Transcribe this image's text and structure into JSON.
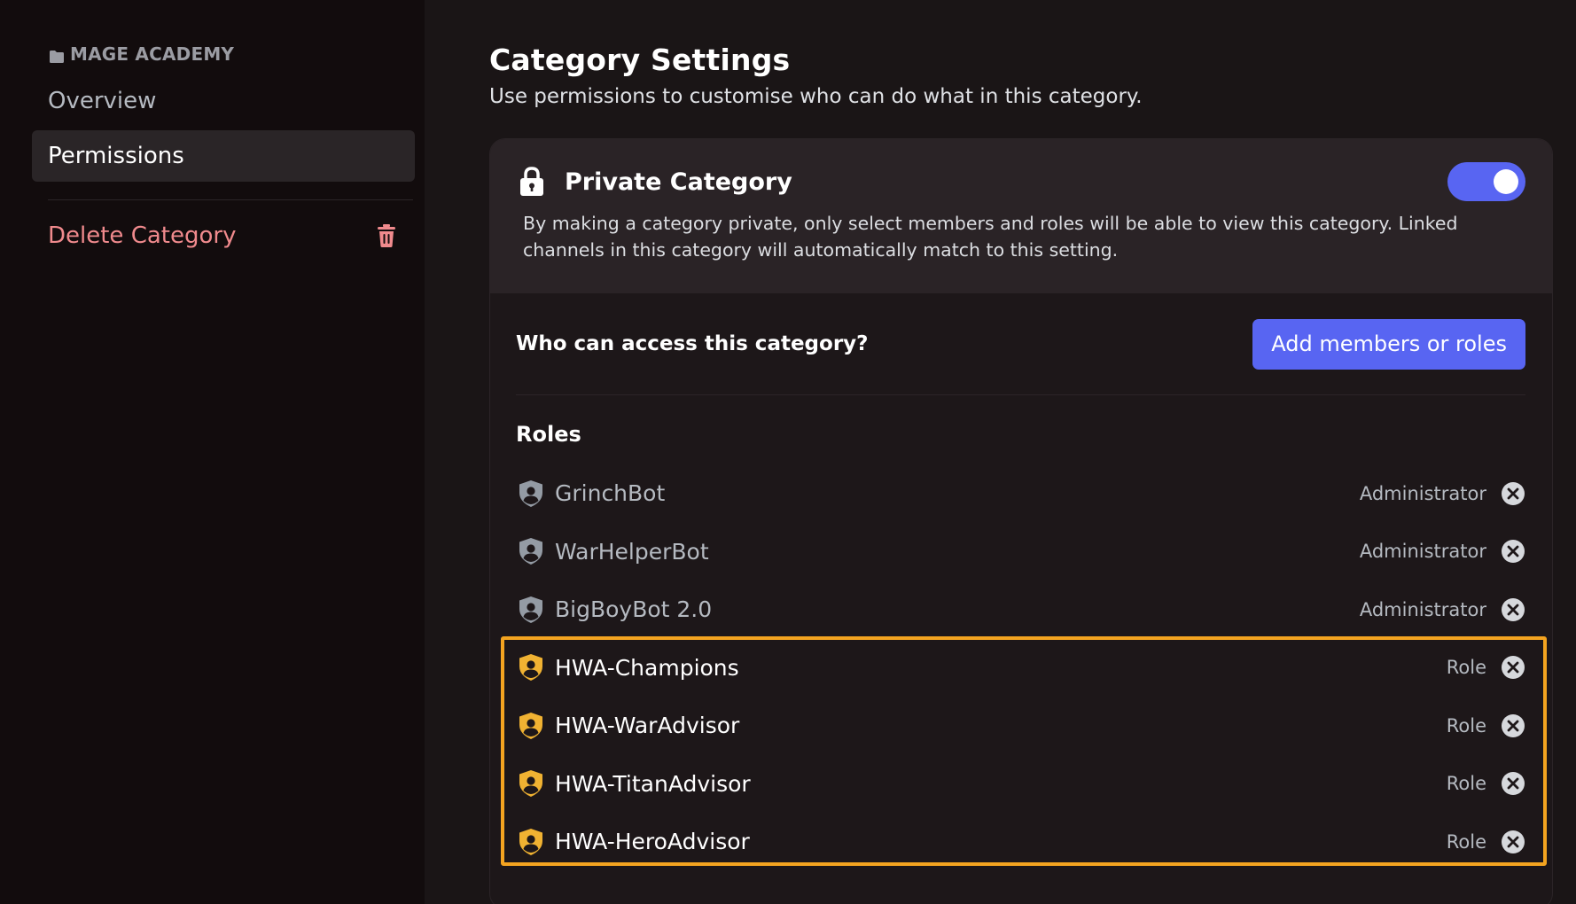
{
  "sidebar": {
    "category_name": "MAGE ACADEMY",
    "items": [
      {
        "label": "Overview"
      },
      {
        "label": "Permissions"
      }
    ],
    "delete_label": "Delete Category"
  },
  "main": {
    "title": "Category Settings",
    "subtitle": "Use permissions to customise who can do what in this category.",
    "private": {
      "title": "Private Category",
      "enabled": true,
      "description": "By making a category private, only select members and roles will be able to view this category. Linked channels in this category will automatically match to this setting."
    },
    "access": {
      "title": "Who can access this category?",
      "add_button": "Add members or roles"
    },
    "roles_header": "Roles",
    "roles": [
      {
        "name": "GrinchBot",
        "type": "Administrator"
      },
      {
        "name": "WarHelperBot",
        "type": "Administrator"
      },
      {
        "name": "BigBoyBot 2.0",
        "type": "Administrator"
      },
      {
        "name": "HWA-Champions",
        "type": "Role"
      },
      {
        "name": "HWA-WarAdvisor",
        "type": "Role"
      },
      {
        "name": "HWA-TitanAdvisor",
        "type": "Role"
      },
      {
        "name": "HWA-HeroAdvisor",
        "type": "Role"
      }
    ]
  },
  "colors": {
    "accent": "#5865f2",
    "danger": "#f08a8d",
    "admin_shield": "#949ba4",
    "role_shield": "#f0b232",
    "highlight": "#f4a420"
  }
}
